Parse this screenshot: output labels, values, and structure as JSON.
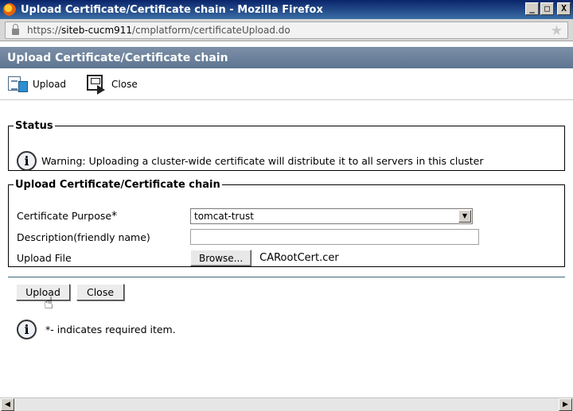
{
  "window": {
    "title": "Upload Certificate/Certificate chain - Mozilla Firefox",
    "controls": [
      "_",
      "□",
      "X"
    ]
  },
  "urlbar": {
    "scheme": "https://",
    "host": "siteb-cucm911",
    "path": "/cmplatform/certificateUpload.do"
  },
  "page": {
    "title": "Upload Certificate/Certificate chain"
  },
  "toolbar": {
    "upload_label": "Upload",
    "close_label": "Close"
  },
  "status": {
    "legend": "Status",
    "message": "Warning: Uploading a cluster-wide certificate will distribute it to all servers in this cluster"
  },
  "upload_section": {
    "legend": "Upload Certificate/Certificate chain",
    "purpose_label": "Certificate Purpose",
    "required_mark": "*",
    "purpose_value": "tomcat-trust",
    "description_label": "Description(friendly name)",
    "description_value": "",
    "upload_file_label": "Upload File",
    "browse_label": "Browse...",
    "file_name": "CARootCert.cer"
  },
  "buttons": {
    "upload_label": "Upload",
    "close_label": "Close"
  },
  "note": {
    "star": "*",
    "text": "- indicates required item."
  },
  "colors": {
    "titlebar": "#0a246a",
    "page_header": "#6b819b"
  }
}
